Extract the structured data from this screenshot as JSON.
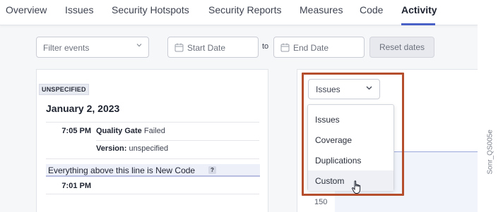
{
  "nav": {
    "tabs": [
      "Overview",
      "Issues",
      "Security Hotspots",
      "Security Reports",
      "Measures",
      "Code",
      "Activity"
    ],
    "active_tab": "Activity"
  },
  "filters": {
    "event_filter_placeholder": "Filter events",
    "start_date_placeholder": "Start Date",
    "to_label": "to",
    "end_date_placeholder": "End Date",
    "reset_label": "Reset dates"
  },
  "activity": {
    "version_badge": "UNSPECIFIED",
    "date": "January 2, 2023",
    "events": [
      {
        "time": "7:05 PM",
        "label": "Quality Gate",
        "value": "Failed"
      },
      {
        "time": "",
        "label": "Version:",
        "value": "unspecified"
      }
    ],
    "new_code_notice": "Everything above this line is New Code",
    "new_code_help": "?",
    "next_time": "7:01 PM"
  },
  "chart": {
    "metric_selected": "Issues",
    "metric_options": [
      "Issues",
      "Coverage",
      "Duplications",
      "Custom"
    ],
    "hovered_option": "Custom",
    "y_tick": "150"
  },
  "watermark": "Sonr_QS005e",
  "colors": {
    "accent": "#4a62c6",
    "highlight_border": "#b44e2d",
    "chart_line": "#9aa7db"
  }
}
